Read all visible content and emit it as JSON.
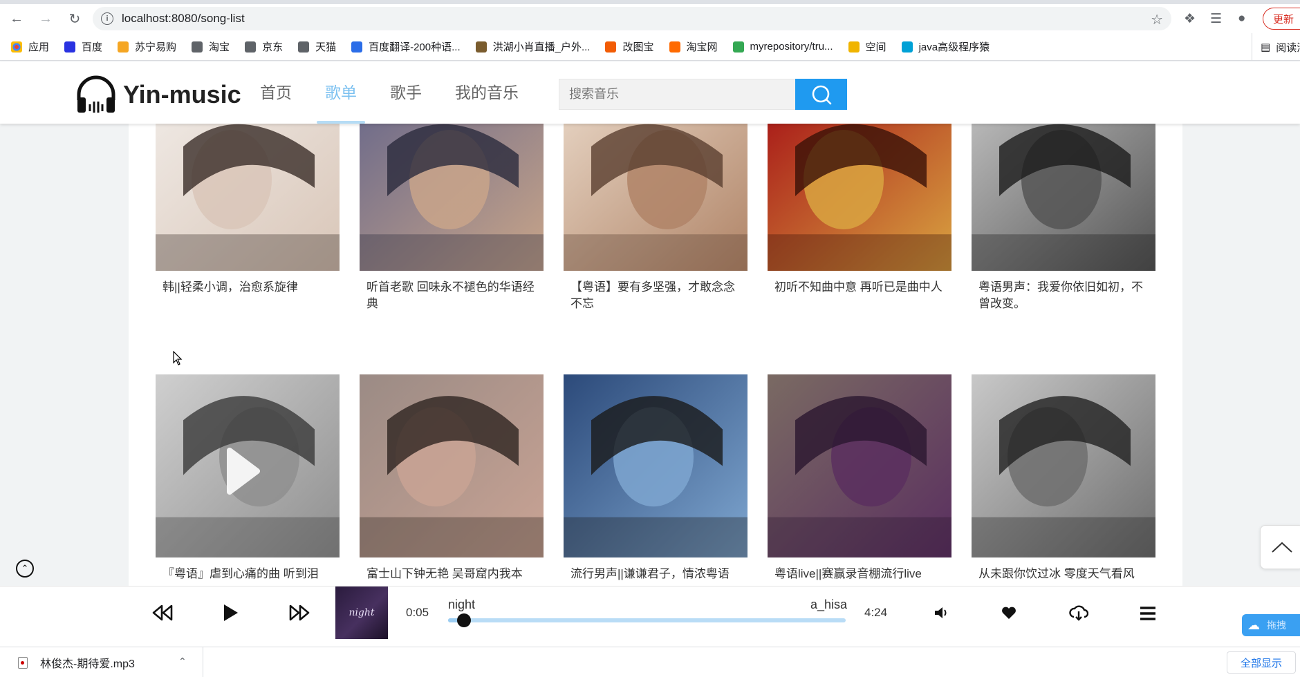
{
  "browser": {
    "url": "localhost:8080/song-list",
    "update_label": "更新",
    "bookmarks": [
      {
        "label": "应用",
        "color": "#4285f4"
      },
      {
        "label": "百度",
        "color": "#2932e1"
      },
      {
        "label": "苏宁易购",
        "color": "#f5a623"
      },
      {
        "label": "淘宝",
        "color": "#5f6368"
      },
      {
        "label": "京东",
        "color": "#5f6368"
      },
      {
        "label": "天猫",
        "color": "#5f6368"
      },
      {
        "label": "百度翻译-200种语...",
        "color": "#2b6de8"
      },
      {
        "label": "洪湖小肖直播_户外...",
        "color": "#7a5c2e"
      },
      {
        "label": "改图宝",
        "color": "#f25c05"
      },
      {
        "label": "淘宝网",
        "color": "#ff6a00"
      },
      {
        "label": "myrepository/tru...",
        "color": "#34a853"
      },
      {
        "label": "空间",
        "color": "#f0b400"
      },
      {
        "label": "java高级程序猿",
        "color": "#00a1d6"
      }
    ],
    "reading_list": "阅读清单"
  },
  "site": {
    "logo": "Yin-music",
    "nav": [
      {
        "label": "首页",
        "active": false
      },
      {
        "label": "歌单",
        "active": true
      },
      {
        "label": "歌手",
        "active": false
      },
      {
        "label": "我的音乐",
        "active": false
      }
    ],
    "search_placeholder": "搜索音乐"
  },
  "playlists": [
    {
      "title": "韩||轻柔小调，治愈系旋律"
    },
    {
      "title": "听首老歌 回味永不褪色的华语经典"
    },
    {
      "title": "【粤语】要有多坚强，才敢念念不忘"
    },
    {
      "title": "初听不知曲中意 再听已是曲中人"
    },
    {
      "title": "粤语男声：我爱你依旧如初，不曾改变。"
    },
    {
      "title": "『粤语』虐到心痛的曲 听到泪"
    },
    {
      "title": "富士山下钟无艳 吴哥窟内我本"
    },
    {
      "title": "流行男声||谦谦君子，情浓粤语"
    },
    {
      "title": "粤语live||赛赢录音棚流行live"
    },
    {
      "title": "从未跟你饮过冰 零度天气看风"
    }
  ],
  "player": {
    "album_text": "night",
    "current_time": "0:05",
    "song_name": "night",
    "artist": "a_hisa",
    "total_time": "4:24",
    "progress": 0.04,
    "cloud_label": "拖拽"
  },
  "downloads": {
    "file_name": "林俊杰-期待爱.mp3",
    "show_all_label": "全部显示"
  }
}
